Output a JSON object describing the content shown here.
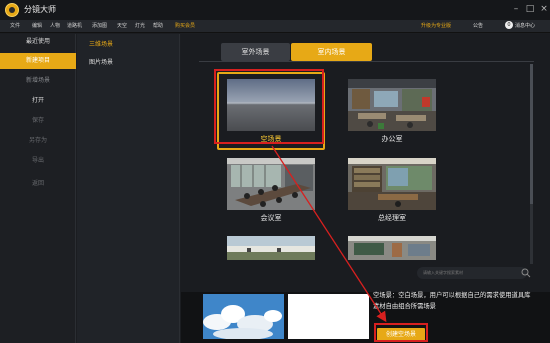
{
  "app": {
    "title": "分镜大师",
    "window_controls": [
      "minimize-icon",
      "maximize-icon",
      "close-icon"
    ]
  },
  "menu": {
    "items": [
      "文件",
      "编辑",
      "人物",
      "道路机",
      "添加图",
      "天空",
      "灯光",
      "帮助",
      "购买会员"
    ],
    "pro_label": "升级为专业版",
    "notice_label": "公告",
    "messages_count": "0",
    "messages_label": "消息中心"
  },
  "sidebar": {
    "items": [
      "最近使用",
      "新建项目",
      "新增场景",
      "打开",
      "保存",
      "另存为",
      "导出",
      "返回"
    ]
  },
  "subnav": {
    "items": [
      "三维场景",
      "图片场景"
    ]
  },
  "tabs": {
    "outdoor": "室外场景",
    "indoor": "室内场景"
  },
  "scenes": [
    {
      "label": "空场景"
    },
    {
      "label": "办公室"
    },
    {
      "label": "会议室"
    },
    {
      "label": "总经理室"
    },
    {
      "label": ""
    },
    {
      "label": ""
    }
  ],
  "search": {
    "placeholder": "请输入关键字搜索素材"
  },
  "details": {
    "description": "空场景：空白场景，用户可以根据自己的需求使用道具库素材自由组合所需场景",
    "create_button": "创建空场景"
  },
  "colors": {
    "accent": "#e7a916",
    "annotation": "#d7201f"
  }
}
